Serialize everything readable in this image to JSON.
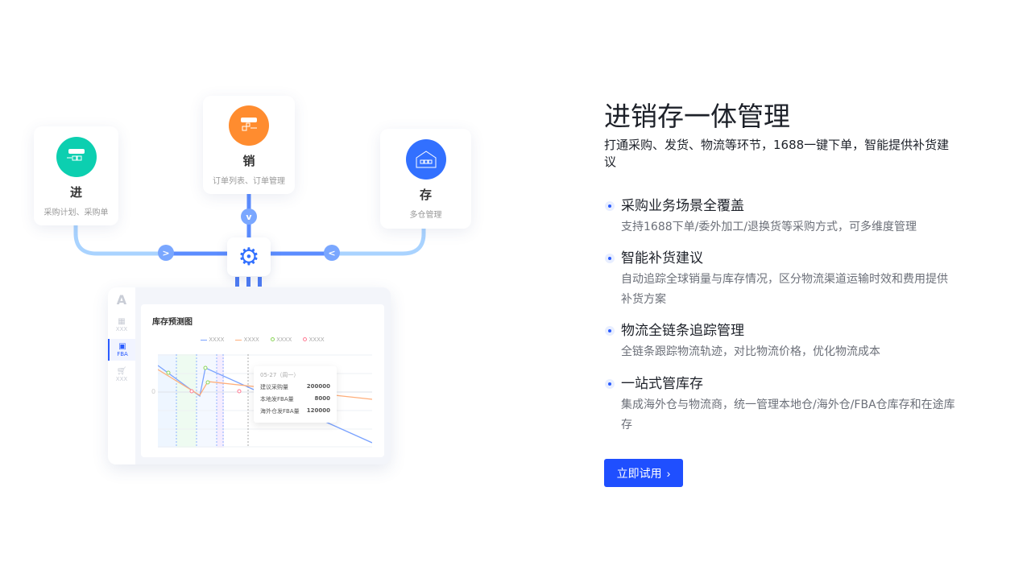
{
  "diagram": {
    "nodes": [
      {
        "title": "进",
        "subtitle": "采购计划、采购单",
        "icon": "store-inbound-icon",
        "color": "#0ccfb0"
      },
      {
        "title": "销",
        "subtitle": "订单列表、订单管理",
        "icon": "store-outbound-icon",
        "color": "#ff8c2f"
      },
      {
        "title": "存",
        "subtitle": "多仓管理",
        "icon": "warehouse-icon",
        "color": "#3270ff"
      }
    ],
    "hub_icon": "gear-icon"
  },
  "mock_app": {
    "sidebar": [
      {
        "label": "XXX",
        "icon": "bank-icon"
      },
      {
        "label": "FBA",
        "icon": "fba-icon",
        "active": true
      },
      {
        "label": "XXX",
        "icon": "cart-icon"
      }
    ],
    "chart_title": "库存预测图",
    "legend": [
      {
        "label": "XXXX",
        "color": "#7aa2ff",
        "type": "line"
      },
      {
        "label": "XXXX",
        "color": "#ffae7a",
        "type": "line"
      },
      {
        "label": "XXXX",
        "color": "#8bd65a",
        "type": "circle"
      },
      {
        "label": "XXXX",
        "color": "#ff7a93",
        "type": "circle"
      }
    ],
    "y_tick": "0",
    "tooltip": {
      "date": "05-27（周一）",
      "rows": [
        {
          "label": "建议采购量",
          "value": "200000"
        },
        {
          "label": "本地发FBA量",
          "value": "8000"
        },
        {
          "label": "海外仓发FBA量",
          "value": "120000"
        }
      ]
    }
  },
  "hero": {
    "title": "进销存一体管理",
    "subtitle": "打通采购、发货、物流等环节，1688一键下单，智能提供补货建议",
    "features": [
      {
        "title": "采购业务场景全覆盖",
        "desc": "支持1688下单/委外加工/退换货等采购方式，可多维度管理"
      },
      {
        "title": "智能补货建议",
        "desc": "自动追踪全球销量与库存情况，区分物流渠道运输时效和费用提供补货方案"
      },
      {
        "title": "物流全链条追踪管理",
        "desc": "全链条跟踪物流轨迹，对比物流价格，优化物流成本"
      },
      {
        "title": "一站式管库存",
        "desc": "集成海外仓与物流商，统一管理本地仓/海外仓/FBA仓库存和在途库存"
      }
    ],
    "cta": "立即试用",
    "accent": "#1f4fff"
  }
}
